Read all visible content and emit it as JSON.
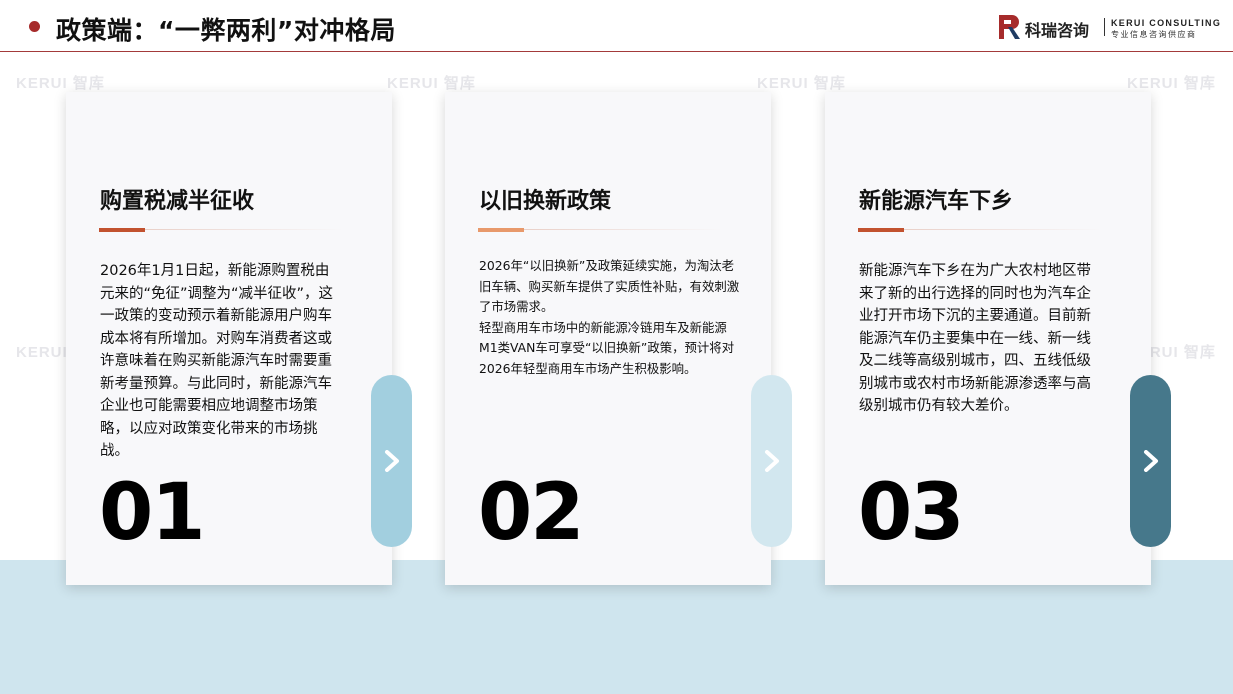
{
  "header": {
    "title": "政策端：“一弊两利”对冲格局"
  },
  "logo": {
    "name_cn": "科瑞咨询",
    "name_en": "KERUI CONSULTING",
    "tagline": "专业信息咨询供应商",
    "brand_color": "#a62b2b"
  },
  "watermark": {
    "text": "KERUI 智库"
  },
  "cards": [
    {
      "heading": "购置税减半征收",
      "body": "2026年1月1日起，新能源购置税由元来的“免征”调整为“减半征收”，这一政策的变动预示着新能源用户购车成本将有所增加。对购车消费者这或许意味着在购买新能源汽车时需要重新考量预算。与此同时，新能源汽车企业也可能需要相应地调整市场策略，以应对政策变化带来的市场挑战。",
      "number": "01",
      "accent_color": "#c2522f",
      "tab_color": "#a2cfdf",
      "icon": "chevron-right-icon"
    },
    {
      "heading": "以旧换新政策",
      "body_lines": [
        "2026年“以旧换新”及政策延续实施，为淘汰老旧车辆、购买新车提供了实质性补贴，有效刺激了市场需求。",
        "轻型商用车市场中的新能源冷链用车及新能源M1类VAN车可享受“以旧换新”政策，预计将对2026年轻型商用车市场产生积极影响。"
      ],
      "number": "02",
      "accent_color": "#e8996b",
      "tab_color": "#d2e7ef",
      "icon": "chevron-right-icon"
    },
    {
      "heading": "新能源汽车下乡",
      "body": "新能源汽车下乡在为广大农村地区带来了新的出行选择的同时也为汽车企业打开市场下沉的主要通道。目前新能源汽车仍主要集中在一线、新一线及二线等高级别城市，四、五线低级别城市或农村市场新能源渗透率与高级别城市仍有较大差价。",
      "number": "03",
      "accent_color": "#c2522f",
      "tab_color": "#46788b",
      "icon": "chevron-right-icon"
    }
  ]
}
